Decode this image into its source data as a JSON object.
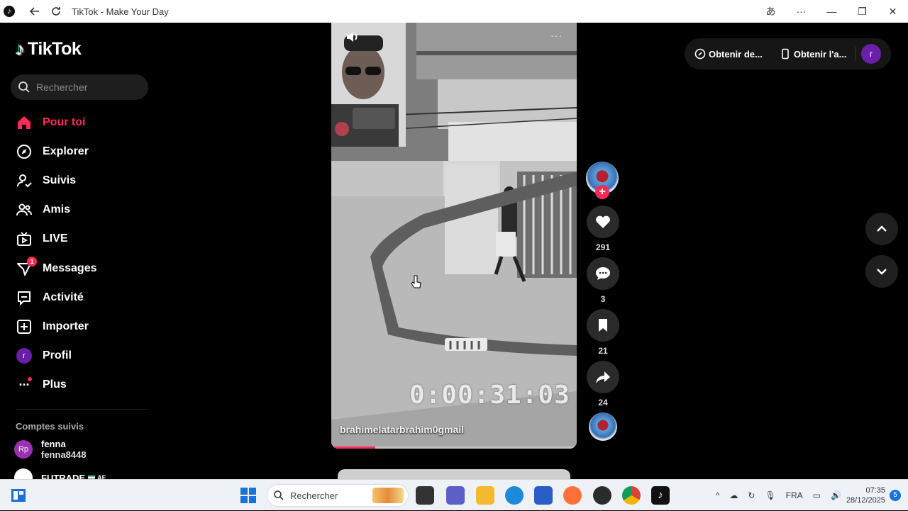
{
  "window": {
    "title": "TikTok - Make Your Day"
  },
  "sidebar": {
    "brand": "TikTok",
    "search_placeholder": "Rechercher",
    "items": [
      {
        "label": "Pour toi",
        "icon": "home-icon",
        "active": true
      },
      {
        "label": "Explorer",
        "icon": "compass-icon"
      },
      {
        "label": "Suivis",
        "icon": "following-icon"
      },
      {
        "label": "Amis",
        "icon": "friends-icon"
      },
      {
        "label": "LIVE",
        "icon": "live-icon"
      },
      {
        "label": "Messages",
        "icon": "messages-icon",
        "badge": "1"
      },
      {
        "label": "Activité",
        "icon": "activity-icon"
      },
      {
        "label": "Importer",
        "icon": "upload-icon"
      },
      {
        "label": "Profil",
        "icon": "avatar",
        "avatar_letter": "r"
      },
      {
        "label": "Plus",
        "icon": "more-icon"
      }
    ],
    "followed_title": "Comptes suivis",
    "followed": [
      {
        "avatar": "Rp",
        "name": "fenna",
        "handle": "fenna8448"
      },
      {
        "name": "FUTRADE",
        "suffix": "AE"
      }
    ]
  },
  "video": {
    "timecode": "0:00:31:03",
    "username": "brahimelatarbrahim0gmail",
    "progress": 0.18
  },
  "actions": {
    "likes": "291",
    "comments": "3",
    "saves": "21",
    "shares": "24"
  },
  "top_bar": {
    "get_coins": "Obtenir de...",
    "get_app": "Obtenir l'a...",
    "user_letter": "r"
  },
  "taskbar": {
    "search_placeholder": "Rechercher",
    "language": "FRA",
    "time": "07:35",
    "date": "28/12/2025",
    "notifications": "5"
  },
  "colors": {
    "accent": "#fe2c55",
    "avatar": "#6b1fa8"
  }
}
